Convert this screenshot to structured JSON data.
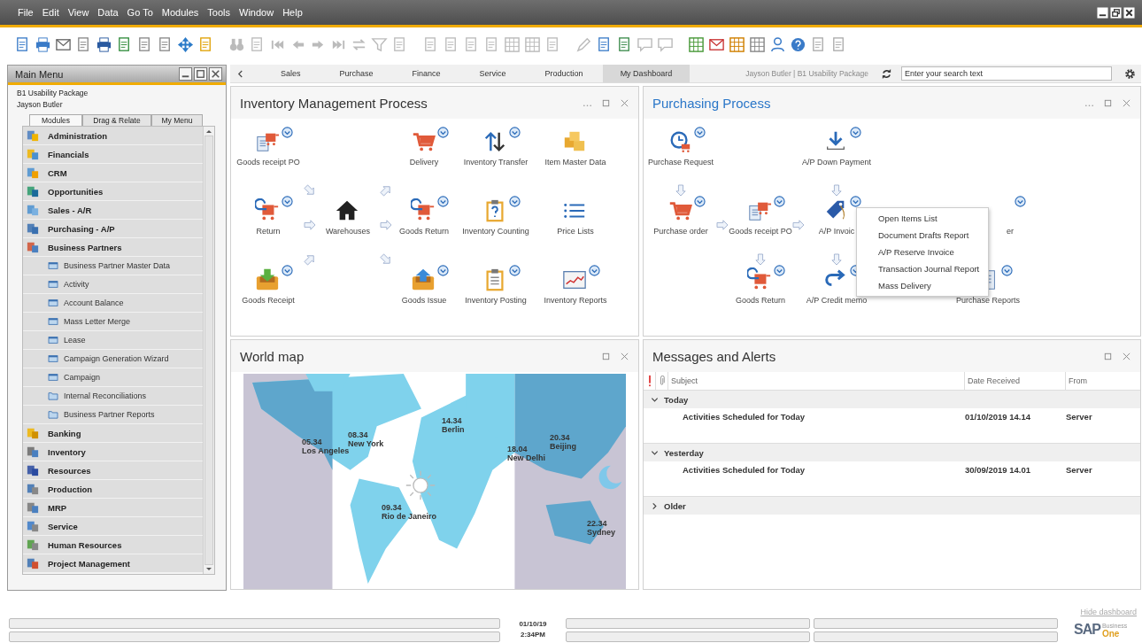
{
  "menu_bar": [
    "File",
    "Edit",
    "View",
    "Data",
    "Go To",
    "Modules",
    "Tools",
    "Window",
    "Help"
  ],
  "main_menu": {
    "title": "Main Menu",
    "company": "B1 Usability Package",
    "user": "Jayson Butler",
    "tabs": [
      {
        "label": "Modules",
        "selected": true
      },
      {
        "label": "Drag & Relate",
        "selected": false
      },
      {
        "label": "My Menu",
        "selected": false
      }
    ],
    "items": [
      {
        "label": "Administration"
      },
      {
        "label": "Financials"
      },
      {
        "label": "CRM"
      },
      {
        "label": "Opportunities"
      },
      {
        "label": "Sales - A/R"
      },
      {
        "label": "Purchasing - A/P"
      },
      {
        "label": "Business Partners",
        "children": [
          {
            "label": "Business Partner Master Data",
            "kind": "form"
          },
          {
            "label": "Activity",
            "kind": "form"
          },
          {
            "label": "Account Balance",
            "kind": "form"
          },
          {
            "label": "Mass Letter Merge",
            "kind": "form"
          },
          {
            "label": "Lease",
            "kind": "form"
          },
          {
            "label": "Campaign Generation Wizard",
            "kind": "form"
          },
          {
            "label": "Campaign",
            "kind": "form"
          },
          {
            "label": "Internal Reconciliations",
            "kind": "folder"
          },
          {
            "label": "Business Partner Reports",
            "kind": "folder"
          }
        ]
      },
      {
        "label": "Banking"
      },
      {
        "label": "Inventory"
      },
      {
        "label": "Resources"
      },
      {
        "label": "Production"
      },
      {
        "label": "MRP"
      },
      {
        "label": "Service"
      },
      {
        "label": "Human Resources"
      },
      {
        "label": "Project Management"
      }
    ]
  },
  "dashboard_tabs": [
    {
      "label": "Sales",
      "selected": false
    },
    {
      "label": "Purchase",
      "selected": false
    },
    {
      "label": "Finance",
      "selected": false
    },
    {
      "label": "Service",
      "selected": false
    },
    {
      "label": "Production",
      "selected": false
    },
    {
      "label": "My Dashboard",
      "selected": true
    }
  ],
  "user_info": "Jayson Butler | B1 Usability Package",
  "search": {
    "placeholder": "Enter your search text"
  },
  "inventory_panel": {
    "title": "Inventory Management Process",
    "active": false,
    "rows": [
      [
        {
          "kind": "receipt",
          "label": "Goods receipt PO",
          "menu": true
        },
        {
          "kind": "empty"
        },
        {
          "kind": "empty"
        },
        {
          "kind": "empty"
        },
        {
          "kind": "cart",
          "label": "Delivery",
          "menu": true
        },
        {
          "kind": "transfer",
          "label": "Inventory Transfer",
          "menu": true
        },
        {
          "kind": "boxes",
          "label": "Item Master Data",
          "menu": false
        }
      ],
      [
        {
          "kind": "empty"
        },
        {
          "kind": "arrowdownright"
        },
        {
          "kind": "empty"
        },
        {
          "kind": "arrowupright"
        },
        {
          "kind": "empty"
        },
        {
          "kind": "empty"
        },
        {
          "kind": "empty"
        }
      ],
      [
        {
          "kind": "returncart",
          "label": "Return",
          "menu": true
        },
        {
          "kind": "arrowright"
        },
        {
          "kind": "house",
          "label": "Warehouses",
          "menu": false
        },
        {
          "kind": "arrowright"
        },
        {
          "kind": "returncart",
          "label": "Goods Return",
          "menu": true
        },
        {
          "kind": "counting",
          "label": "Inventory Counting",
          "menu": true
        },
        {
          "kind": "list",
          "label": "Price Lists",
          "menu": false
        }
      ],
      [
        {
          "kind": "empty"
        },
        {
          "kind": "arrowupright"
        },
        {
          "kind": "empty"
        },
        {
          "kind": "arrowdownright"
        },
        {
          "kind": "empty"
        },
        {
          "kind": "empty"
        },
        {
          "kind": "empty"
        }
      ],
      [
        {
          "kind": "trayin",
          "label": "Goods Receipt",
          "menu": true
        },
        {
          "kind": "empty"
        },
        {
          "kind": "empty"
        },
        {
          "kind": "empty"
        },
        {
          "kind": "trayout",
          "label": "Goods Issue",
          "menu": true
        },
        {
          "kind": "posting",
          "label": "Inventory Posting",
          "menu": true
        },
        {
          "kind": "chart",
          "label": "Inventory Reports",
          "menu": true
        }
      ]
    ]
  },
  "purchasing_panel": {
    "title": "Purchasing Process",
    "active": true,
    "rows": [
      [
        {
          "kind": "request",
          "label": "Purchase Request",
          "menu": true
        },
        {
          "kind": "empty"
        },
        {
          "kind": "empty"
        },
        {
          "kind": "empty"
        },
        {
          "kind": "download",
          "label": "A/P Down Payment",
          "menu": true
        },
        {
          "kind": "empty"
        },
        {
          "kind": "empty"
        }
      ],
      [
        {
          "kind": "arrowdown"
        },
        {
          "kind": "empty"
        },
        {
          "kind": "empty"
        },
        {
          "kind": "empty"
        },
        {
          "kind": "arrowdown"
        },
        {
          "kind": "empty"
        },
        {
          "kind": "empty"
        }
      ],
      [
        {
          "kind": "cart",
          "label": "Purchase order",
          "menu": true
        },
        {
          "kind": "arrowright"
        },
        {
          "kind": "receipt",
          "label": "Goods receipt PO",
          "menu": true
        },
        {
          "kind": "arrowright"
        },
        {
          "kind": "tag",
          "label": "A/P Invoic",
          "menu": true
        },
        {
          "kind": "empty"
        },
        {
          "kind": "partial",
          "label": "er",
          "menu": true
        }
      ],
      [
        {
          "kind": "empty"
        },
        {
          "kind": "empty"
        },
        {
          "kind": "arrowdown"
        },
        {
          "kind": "empty"
        },
        {
          "kind": "arrowdown"
        },
        {
          "kind": "empty"
        },
        {
          "kind": "empty"
        }
      ],
      [
        {
          "kind": "empty"
        },
        {
          "kind": "empty"
        },
        {
          "kind": "returncart",
          "label": "Goods Return",
          "menu": true
        },
        {
          "kind": "empty"
        },
        {
          "kind": "credit",
          "label": "A/P Credit memo",
          "menu": true
        },
        {
          "kind": "empty"
        },
        {
          "kind": "report",
          "label": "Purchase Reports",
          "menu": true
        }
      ]
    ],
    "context_menu": [
      "Open Items List",
      "Document Drafts Report",
      "A/P Reserve Invoice",
      "Transaction Journal Report",
      "Mass Delivery"
    ]
  },
  "world_map": {
    "title": "World map",
    "cities": [
      {
        "time": "05.34",
        "name": "Los Angeles"
      },
      {
        "time": "08.34",
        "name": "New York"
      },
      {
        "time": "14.34",
        "name": "Berlin"
      },
      {
        "time": "18.04",
        "name": "New Delhi"
      },
      {
        "time": "20.34",
        "name": "Beijing"
      },
      {
        "time": "09.34",
        "name": "Rio de Janeiro"
      },
      {
        "time": "22.34",
        "name": "Sydney"
      }
    ]
  },
  "messages": {
    "title": "Messages and Alerts",
    "columns": [
      "Subject",
      "Date Received",
      "From"
    ],
    "groups": [
      {
        "label": "Today",
        "expanded": true,
        "rows": [
          {
            "subject": "Activities Scheduled for Today",
            "date": "01/10/2019 14.14",
            "from": "Server"
          }
        ]
      },
      {
        "label": "Yesterday",
        "expanded": true,
        "rows": [
          {
            "subject": "Activities Scheduled for Today",
            "date": "30/09/2019 14.01",
            "from": "Server"
          }
        ]
      },
      {
        "label": "Older",
        "expanded": false
      }
    ]
  },
  "hide_dashboard": "Hide dashboard",
  "status_bar": {
    "date": "01/10/19",
    "time": "2:34PM"
  },
  "logo": {
    "brand": "SAP",
    "line_1": "Business",
    "line_2": "One"
  }
}
